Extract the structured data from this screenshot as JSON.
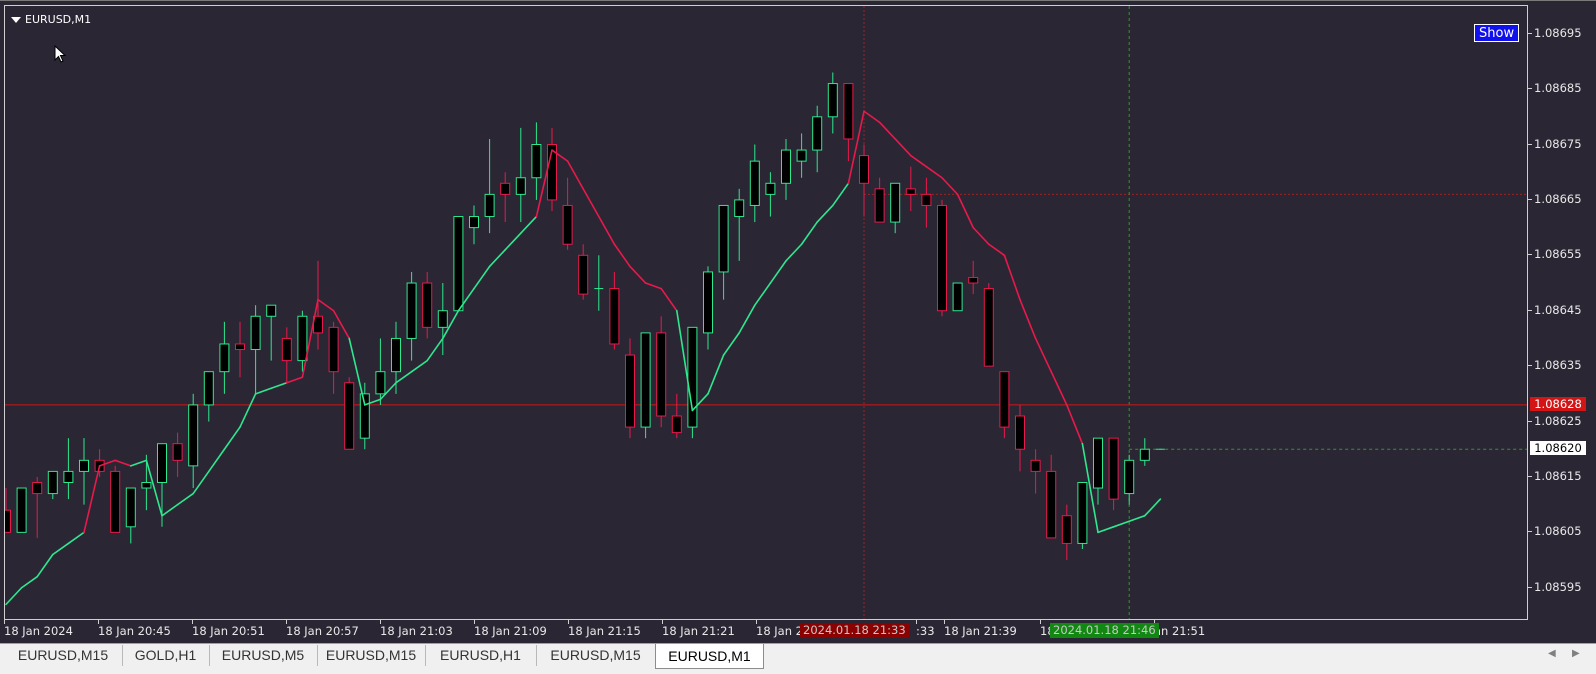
{
  "window": {
    "title": "EURUSD,M1",
    "show_button": "Show"
  },
  "colors": {
    "background": "#2b2634",
    "bull_candle": "#2ee88e",
    "bear_candle": "#e8194b",
    "indicator_up": "#2ee88e",
    "indicator_down": "#e8194b",
    "bid_line": "#d41515",
    "crosshair": "#9e2020",
    "green_crosshair": "#2a9a2a"
  },
  "price_axis": {
    "ticks": [
      "1.08695",
      "1.08685",
      "1.08675",
      "1.08665",
      "1.08655",
      "1.08645",
      "1.08635",
      "1.08625",
      "1.08615",
      "1.08605",
      "1.08595"
    ],
    "bid_label": "1.08628",
    "current_label": "1.08620"
  },
  "time_axis": {
    "ticks": [
      "18 Jan 2024",
      "18 Jan 20:45",
      "18 Jan 20:51",
      "18 Jan 20:57",
      "18 Jan 21:03",
      "18 Jan 21:09",
      "18 Jan 21:15",
      "18 Jan 21:21",
      "18 Jan 2",
      "18 Jan 21:39",
      "18",
      "an 21:51"
    ],
    "red_crosshair_label": "2024.01.18 21:33",
    "red_crosshair_suffix": ":33",
    "green_crosshair_label": "2024.01.18 21:46"
  },
  "chart_data": {
    "type": "candlestick",
    "symbol": "EURUSD",
    "timeframe": "M1",
    "ylim": [
      1.08589,
      1.087
    ],
    "candles": [
      {
        "o": 1.08609,
        "h": 1.08613,
        "l": 1.08605,
        "c": 1.08605
      },
      {
        "o": 1.08605,
        "h": 1.08613,
        "l": 1.08605,
        "c": 1.08613
      },
      {
        "o": 1.08614,
        "h": 1.08615,
        "l": 1.08604,
        "c": 1.08612
      },
      {
        "o": 1.08612,
        "h": 1.08616,
        "l": 1.08611,
        "c": 1.08616
      },
      {
        "o": 1.08614,
        "h": 1.08622,
        "l": 1.08611,
        "c": 1.08616
      },
      {
        "o": 1.08616,
        "h": 1.08622,
        "l": 1.0861,
        "c": 1.08618
      },
      {
        "o": 1.08618,
        "h": 1.0862,
        "l": 1.08615,
        "c": 1.08616
      },
      {
        "o": 1.08616,
        "h": 1.08617,
        "l": 1.08605,
        "c": 1.08605
      },
      {
        "o": 1.08606,
        "h": 1.08613,
        "l": 1.08603,
        "c": 1.08613
      },
      {
        "o": 1.08613,
        "h": 1.08619,
        "l": 1.08609,
        "c": 1.08614
      },
      {
        "o": 1.08614,
        "h": 1.08619,
        "l": 1.08606,
        "c": 1.08621
      },
      {
        "o": 1.08621,
        "h": 1.08623,
        "l": 1.08615,
        "c": 1.08618
      },
      {
        "o": 1.08617,
        "h": 1.0863,
        "l": 1.08613,
        "c": 1.08628
      },
      {
        "o": 1.08628,
        "h": 1.08634,
        "l": 1.08625,
        "c": 1.08634
      },
      {
        "o": 1.08634,
        "h": 1.08643,
        "l": 1.0863,
        "c": 1.08639
      },
      {
        "o": 1.08639,
        "h": 1.08643,
        "l": 1.08633,
        "c": 1.08638
      },
      {
        "o": 1.08638,
        "h": 1.08646,
        "l": 1.0863,
        "c": 1.08644
      },
      {
        "o": 1.08644,
        "h": 1.08646,
        "l": 1.08636,
        "c": 1.08646
      },
      {
        "o": 1.0864,
        "h": 1.08642,
        "l": 1.08632,
        "c": 1.08636
      },
      {
        "o": 1.08636,
        "h": 1.08645,
        "l": 1.08634,
        "c": 1.08644
      },
      {
        "o": 1.08644,
        "h": 1.08654,
        "l": 1.08638,
        "c": 1.08641
      },
      {
        "o": 1.08642,
        "h": 1.08643,
        "l": 1.0863,
        "c": 1.08634
      },
      {
        "o": 1.08632,
        "h": 1.08633,
        "l": 1.08621,
        "c": 1.0862
      },
      {
        "o": 1.08622,
        "h": 1.08632,
        "l": 1.0862,
        "c": 1.0863
      },
      {
        "o": 1.0863,
        "h": 1.0864,
        "l": 1.08628,
        "c": 1.08634
      },
      {
        "o": 1.08634,
        "h": 1.08643,
        "l": 1.0863,
        "c": 1.0864
      },
      {
        "o": 1.0864,
        "h": 1.08652,
        "l": 1.08636,
        "c": 1.0865
      },
      {
        "o": 1.0865,
        "h": 1.08652,
        "l": 1.0864,
        "c": 1.08642
      },
      {
        "o": 1.08642,
        "h": 1.0865,
        "l": 1.08637,
        "c": 1.08645
      },
      {
        "o": 1.08645,
        "h": 1.08662,
        "l": 1.08645,
        "c": 1.08662
      },
      {
        "o": 1.0866,
        "h": 1.08664,
        "l": 1.08657,
        "c": 1.08662
      },
      {
        "o": 1.08662,
        "h": 1.08676,
        "l": 1.08659,
        "c": 1.08666
      },
      {
        "o": 1.08668,
        "h": 1.0867,
        "l": 1.08661,
        "c": 1.08666
      },
      {
        "o": 1.08666,
        "h": 1.08678,
        "l": 1.08661,
        "c": 1.08669
      },
      {
        "o": 1.08669,
        "h": 1.08679,
        "l": 1.08665,
        "c": 1.08675
      },
      {
        "o": 1.08675,
        "h": 1.08678,
        "l": 1.08663,
        "c": 1.08665
      },
      {
        "o": 1.08664,
        "h": 1.08669,
        "l": 1.08656,
        "c": 1.08657
      },
      {
        "o": 1.08655,
        "h": 1.08657,
        "l": 1.08647,
        "c": 1.08648
      },
      {
        "o": 1.08649,
        "h": 1.08655,
        "l": 1.08645,
        "c": 1.08649
      },
      {
        "o": 1.08649,
        "h": 1.08652,
        "l": 1.08638,
        "c": 1.08639
      },
      {
        "o": 1.08637,
        "h": 1.0864,
        "l": 1.08622,
        "c": 1.08624
      },
      {
        "o": 1.08624,
        "h": 1.0864,
        "l": 1.08622,
        "c": 1.08641
      },
      {
        "o": 1.08641,
        "h": 1.08644,
        "l": 1.08624,
        "c": 1.08626
      },
      {
        "o": 1.08626,
        "h": 1.0863,
        "l": 1.08622,
        "c": 1.08623
      },
      {
        "o": 1.08624,
        "h": 1.08642,
        "l": 1.08622,
        "c": 1.08642
      },
      {
        "o": 1.08641,
        "h": 1.08653,
        "l": 1.08638,
        "c": 1.08652
      },
      {
        "o": 1.08652,
        "h": 1.08664,
        "l": 1.08647,
        "c": 1.08664
      },
      {
        "o": 1.08662,
        "h": 1.08667,
        "l": 1.08654,
        "c": 1.08665
      },
      {
        "o": 1.08664,
        "h": 1.08675,
        "l": 1.08661,
        "c": 1.08672
      },
      {
        "o": 1.08666,
        "h": 1.0867,
        "l": 1.08662,
        "c": 1.08668
      },
      {
        "o": 1.08668,
        "h": 1.08676,
        "l": 1.08665,
        "c": 1.08674
      },
      {
        "o": 1.08672,
        "h": 1.08677,
        "l": 1.08669,
        "c": 1.08674
      },
      {
        "o": 1.08674,
        "h": 1.08682,
        "l": 1.0867,
        "c": 1.0868
      },
      {
        "o": 1.0868,
        "h": 1.08688,
        "l": 1.08677,
        "c": 1.08686
      },
      {
        "o": 1.08686,
        "h": 1.08686,
        "l": 1.08672,
        "c": 1.08676
      },
      {
        "o": 1.08673,
        "h": 1.08675,
        "l": 1.08662,
        "c": 1.08668
      },
      {
        "o": 1.08667,
        "h": 1.08669,
        "l": 1.08661,
        "c": 1.08661
      },
      {
        "o": 1.08661,
        "h": 1.08668,
        "l": 1.08659,
        "c": 1.08668
      },
      {
        "o": 1.08667,
        "h": 1.08671,
        "l": 1.08663,
        "c": 1.08666
      },
      {
        "o": 1.08666,
        "h": 1.08669,
        "l": 1.0866,
        "c": 1.08664
      },
      {
        "o": 1.08664,
        "h": 1.08665,
        "l": 1.08644,
        "c": 1.08645
      },
      {
        "o": 1.08645,
        "h": 1.0865,
        "l": 1.08645,
        "c": 1.0865
      },
      {
        "o": 1.08651,
        "h": 1.08654,
        "l": 1.08648,
        "c": 1.0865
      },
      {
        "o": 1.08649,
        "h": 1.0865,
        "l": 1.08635,
        "c": 1.08635
      },
      {
        "o": 1.08634,
        "h": 1.08634,
        "l": 1.08622,
        "c": 1.08624
      },
      {
        "o": 1.08626,
        "h": 1.08628,
        "l": 1.08616,
        "c": 1.0862
      },
      {
        "o": 1.08618,
        "h": 1.0862,
        "l": 1.08612,
        "c": 1.08616
      },
      {
        "o": 1.08616,
        "h": 1.08619,
        "l": 1.08604,
        "c": 1.08604
      },
      {
        "o": 1.08608,
        "h": 1.0861,
        "l": 1.086,
        "c": 1.08603
      },
      {
        "o": 1.08603,
        "h": 1.08614,
        "l": 1.08602,
        "c": 1.08614
      },
      {
        "o": 1.08613,
        "h": 1.08622,
        "l": 1.0861,
        "c": 1.08622
      },
      {
        "o": 1.08622,
        "h": 1.08622,
        "l": 1.08609,
        "c": 1.08611
      },
      {
        "o": 1.08612,
        "h": 1.08619,
        "l": 1.0861,
        "c": 1.08618
      },
      {
        "o": 1.08618,
        "h": 1.08622,
        "l": 1.08617,
        "c": 1.0862
      },
      {
        "o": 1.0862,
        "h": 1.0862,
        "l": 1.0862,
        "c": 1.0862
      }
    ],
    "indicator": [
      {
        "v": 1.08592,
        "trend": "up"
      },
      {
        "v": 1.08595,
        "trend": "up"
      },
      {
        "v": 1.08597,
        "trend": "up"
      },
      {
        "v": 1.08601,
        "trend": "up"
      },
      {
        "v": 1.08603,
        "trend": "up"
      },
      {
        "v": 1.08605,
        "trend": "up"
      },
      {
        "v": 1.08617,
        "trend": "down"
      },
      {
        "v": 1.08618,
        "trend": "down"
      },
      {
        "v": 1.08617,
        "trend": "down"
      },
      {
        "v": 1.08618,
        "trend": "up"
      },
      {
        "v": 1.08608,
        "trend": "up"
      },
      {
        "v": 1.0861,
        "trend": "up"
      },
      {
        "v": 1.08612,
        "trend": "up"
      },
      {
        "v": 1.08616,
        "trend": "up"
      },
      {
        "v": 1.0862,
        "trend": "up"
      },
      {
        "v": 1.08624,
        "trend": "up"
      },
      {
        "v": 1.0863,
        "trend": "up"
      },
      {
        "v": 1.08631,
        "trend": "up"
      },
      {
        "v": 1.08632,
        "trend": "up"
      },
      {
        "v": 1.08633,
        "trend": "down"
      },
      {
        "v": 1.08647,
        "trend": "down"
      },
      {
        "v": 1.08645,
        "trend": "down"
      },
      {
        "v": 1.0864,
        "trend": "down"
      },
      {
        "v": 1.08628,
        "trend": "up"
      },
      {
        "v": 1.08629,
        "trend": "up"
      },
      {
        "v": 1.08632,
        "trend": "up"
      },
      {
        "v": 1.08634,
        "trend": "up"
      },
      {
        "v": 1.08636,
        "trend": "up"
      },
      {
        "v": 1.0864,
        "trend": "up"
      },
      {
        "v": 1.08645,
        "trend": "up"
      },
      {
        "v": 1.08649,
        "trend": "up"
      },
      {
        "v": 1.08653,
        "trend": "up"
      },
      {
        "v": 1.08656,
        "trend": "up"
      },
      {
        "v": 1.08659,
        "trend": "up"
      },
      {
        "v": 1.08662,
        "trend": "up"
      },
      {
        "v": 1.08674,
        "trend": "down"
      },
      {
        "v": 1.08672,
        "trend": "down"
      },
      {
        "v": 1.08667,
        "trend": "down"
      },
      {
        "v": 1.08662,
        "trend": "down"
      },
      {
        "v": 1.08657,
        "trend": "down"
      },
      {
        "v": 1.08653,
        "trend": "down"
      },
      {
        "v": 1.0865,
        "trend": "down"
      },
      {
        "v": 1.08649,
        "trend": "down"
      },
      {
        "v": 1.08645,
        "trend": "down"
      },
      {
        "v": 1.08627,
        "trend": "up"
      },
      {
        "v": 1.0863,
        "trend": "up"
      },
      {
        "v": 1.08637,
        "trend": "up"
      },
      {
        "v": 1.08641,
        "trend": "up"
      },
      {
        "v": 1.08646,
        "trend": "up"
      },
      {
        "v": 1.0865,
        "trend": "up"
      },
      {
        "v": 1.08654,
        "trend": "up"
      },
      {
        "v": 1.08657,
        "trend": "up"
      },
      {
        "v": 1.08661,
        "trend": "up"
      },
      {
        "v": 1.08664,
        "trend": "up"
      },
      {
        "v": 1.08668,
        "trend": "up"
      },
      {
        "v": 1.08681,
        "trend": "down"
      },
      {
        "v": 1.08679,
        "trend": "down"
      },
      {
        "v": 1.08676,
        "trend": "down"
      },
      {
        "v": 1.08673,
        "trend": "down"
      },
      {
        "v": 1.08671,
        "trend": "down"
      },
      {
        "v": 1.08669,
        "trend": "down"
      },
      {
        "v": 1.08666,
        "trend": "down"
      },
      {
        "v": 1.0866,
        "trend": "down"
      },
      {
        "v": 1.08657,
        "trend": "down"
      },
      {
        "v": 1.08655,
        "trend": "down"
      },
      {
        "v": 1.08647,
        "trend": "down"
      },
      {
        "v": 1.0864,
        "trend": "down"
      },
      {
        "v": 1.08634,
        "trend": "down"
      },
      {
        "v": 1.08628,
        "trend": "down"
      },
      {
        "v": 1.08621,
        "trend": "down"
      },
      {
        "v": 1.08605,
        "trend": "up"
      },
      {
        "v": 1.08606,
        "trend": "up"
      },
      {
        "v": 1.08607,
        "trend": "up"
      },
      {
        "v": 1.08608,
        "trend": "up"
      },
      {
        "v": 1.08611,
        "trend": "up"
      }
    ],
    "bid_price": 1.08628,
    "current_price": 1.0862,
    "red_crosshair_candle": 55,
    "red_crosshair_price": 1.08666,
    "green_crosshair_candle": 72,
    "green_crosshair_price": 1.0862
  },
  "tabs": [
    {
      "label": "EURUSD,M15",
      "active": false
    },
    {
      "label": "GOLD,H1",
      "active": false
    },
    {
      "label": "EURUSD,M5",
      "active": false
    },
    {
      "label": "EURUSD,M15",
      "active": false
    },
    {
      "label": "EURUSD,H1",
      "active": false
    },
    {
      "label": "EURUSD,M15",
      "active": false
    },
    {
      "label": "EURUSD,M1",
      "active": true
    }
  ],
  "tab_scroll": {
    "left": "◀",
    "right": "▶"
  }
}
